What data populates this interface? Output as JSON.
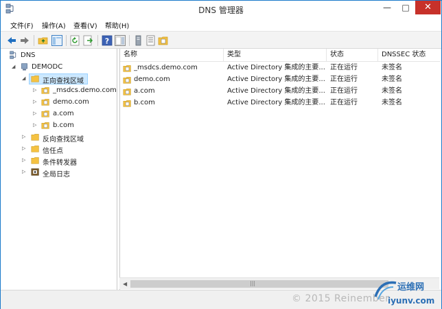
{
  "window": {
    "title": "DNS 管理器",
    "minimize": "—",
    "maximize": "□",
    "close": "✕"
  },
  "menu": [
    "文件(F)",
    "操作(A)",
    "查看(V)",
    "帮助(H)"
  ],
  "tree": {
    "root": "DNS",
    "server": "DEMODC",
    "forward_zones": "正向查找区域",
    "zones": [
      "_msdcs.demo.com",
      "demo.com",
      "a.com",
      "b.com"
    ],
    "reverse_zones": "反向查找区域",
    "trust_points": "信任点",
    "conditional_forwarders": "条件转发器",
    "global_logs": "全局日志"
  },
  "list": {
    "columns": [
      "名称",
      "类型",
      "状态",
      "DNSSEC 状态"
    ],
    "rows": [
      {
        "name": "_msdcs.demo.com",
        "type": "Active Directory 集成的主要...",
        "status": "正在运行",
        "dnssec": "未签名"
      },
      {
        "name": "demo.com",
        "type": "Active Directory 集成的主要...",
        "status": "正在运行",
        "dnssec": "未签名"
      },
      {
        "name": "a.com",
        "type": "Active Directory 集成的主要...",
        "status": "正在运行",
        "dnssec": "未签名"
      },
      {
        "name": "b.com",
        "type": "Active Directory 集成的主要...",
        "status": "正在运行",
        "dnssec": "未签名"
      }
    ]
  },
  "footer": {
    "watermark": "© 2015 Reinember",
    "logo_text": "运维网",
    "logo_url": "iyunv.com"
  },
  "colors": {
    "accent": "#1979ca",
    "close": "#c7312a",
    "selection": "#cce8ff",
    "folder": "#f5c242",
    "logo": "#2c6fb5"
  }
}
